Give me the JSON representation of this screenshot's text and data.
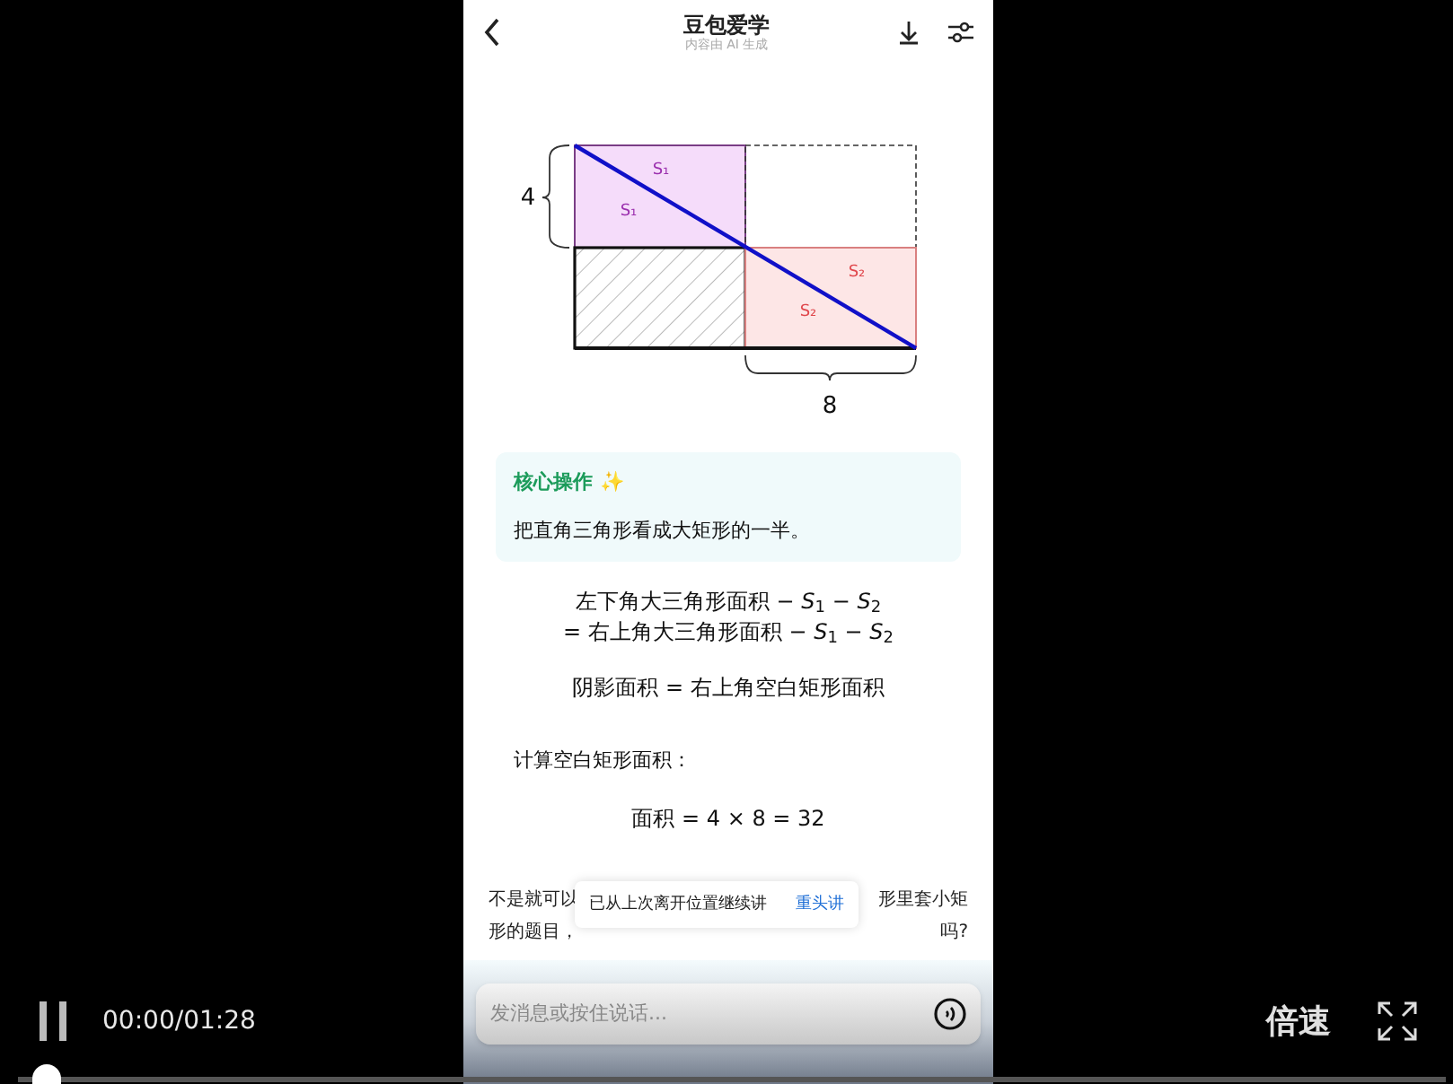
{
  "app": {
    "title": "豆包爱学",
    "subtitle": "内容由 AI 生成"
  },
  "diagram": {
    "side_label": "4",
    "bottom_label": "8",
    "regions": [
      {
        "label": "S₁",
        "color": "#9b2fae"
      },
      {
        "label": "S₁",
        "color": "#9b2fae"
      },
      {
        "label": "S₂",
        "color": "#e0474c"
      },
      {
        "label": "S₂",
        "color": "#e0474c"
      }
    ]
  },
  "callout": {
    "title": "核心操作",
    "emoji": "✨",
    "text": "把直角三角形看成大矩形的一半。"
  },
  "equations": [
    "左下角大三角形面积 − *S*$_{1}$ − *S*$_{2}$",
    "= 右上角大三角形面积 − *S*$_{1}$ − *S*$_{2}$",
    "阴影面积 = 右上角空白矩形面积"
  ],
  "step_label": "计算空白矩形面积：",
  "result": "面积 = 4 × 8 = 32",
  "partial_text": [
    {
      "left": "不是就可以",
      "right": "形里套小矩"
    },
    {
      "left": "形的题目，",
      "right": "吗?"
    }
  ],
  "toast": {
    "text": "已从上次离开位置继续讲",
    "action": "重头讲"
  },
  "input": {
    "placeholder": "发消息或按住说话..."
  },
  "player": {
    "playing": true,
    "time": "00:00/01:28",
    "speed": "倍速",
    "level": 0
  }
}
